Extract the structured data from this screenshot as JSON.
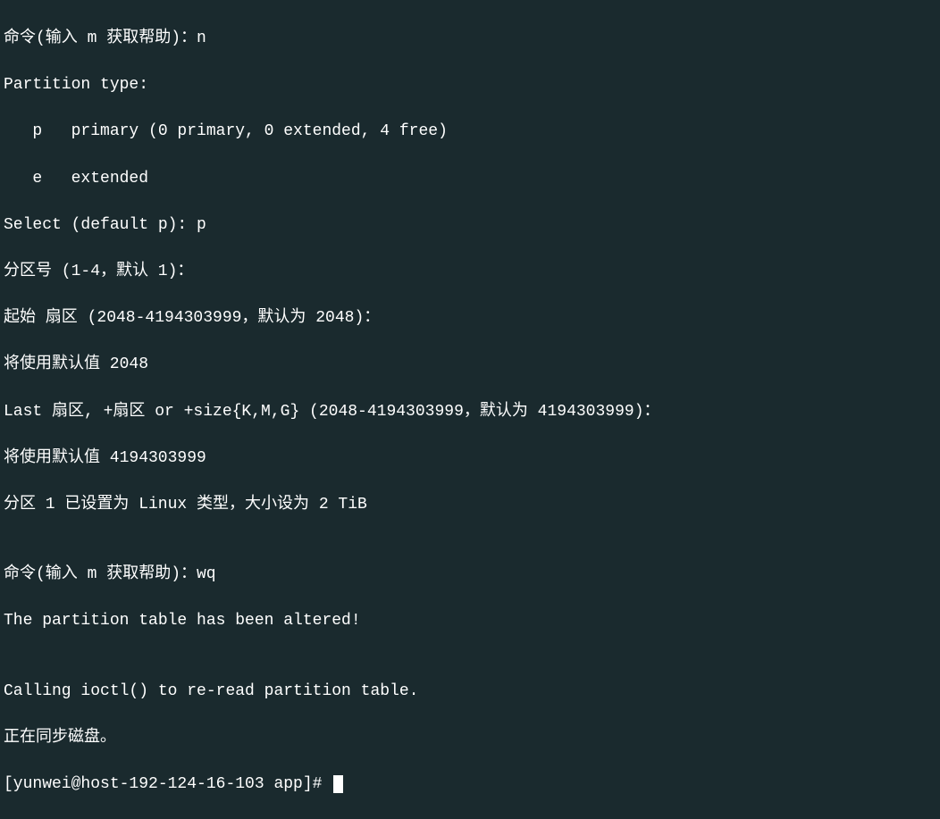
{
  "terminal": {
    "lines": [
      "命令(输入 m 获取帮助)：n",
      "Partition type:",
      "   p   primary (0 primary, 0 extended, 4 free)",
      "   e   extended",
      "Select (default p): p",
      "分区号 (1-4，默认 1)：",
      "起始 扇区 (2048-4194303999，默认为 2048)：",
      "将使用默认值 2048",
      "Last 扇区, +扇区 or +size{K,M,G} (2048-4194303999，默认为 4194303999)：",
      "将使用默认值 4194303999",
      "分区 1 已设置为 Linux 类型，大小设为 2 TiB",
      "",
      "命令(输入 m 获取帮助)：wq",
      "The partition table has been altered!",
      "",
      "Calling ioctl() to re-read partition table.",
      "正在同步磁盘。"
    ],
    "prompt": "[yunwei@host-192-124-16-103 app]# "
  }
}
